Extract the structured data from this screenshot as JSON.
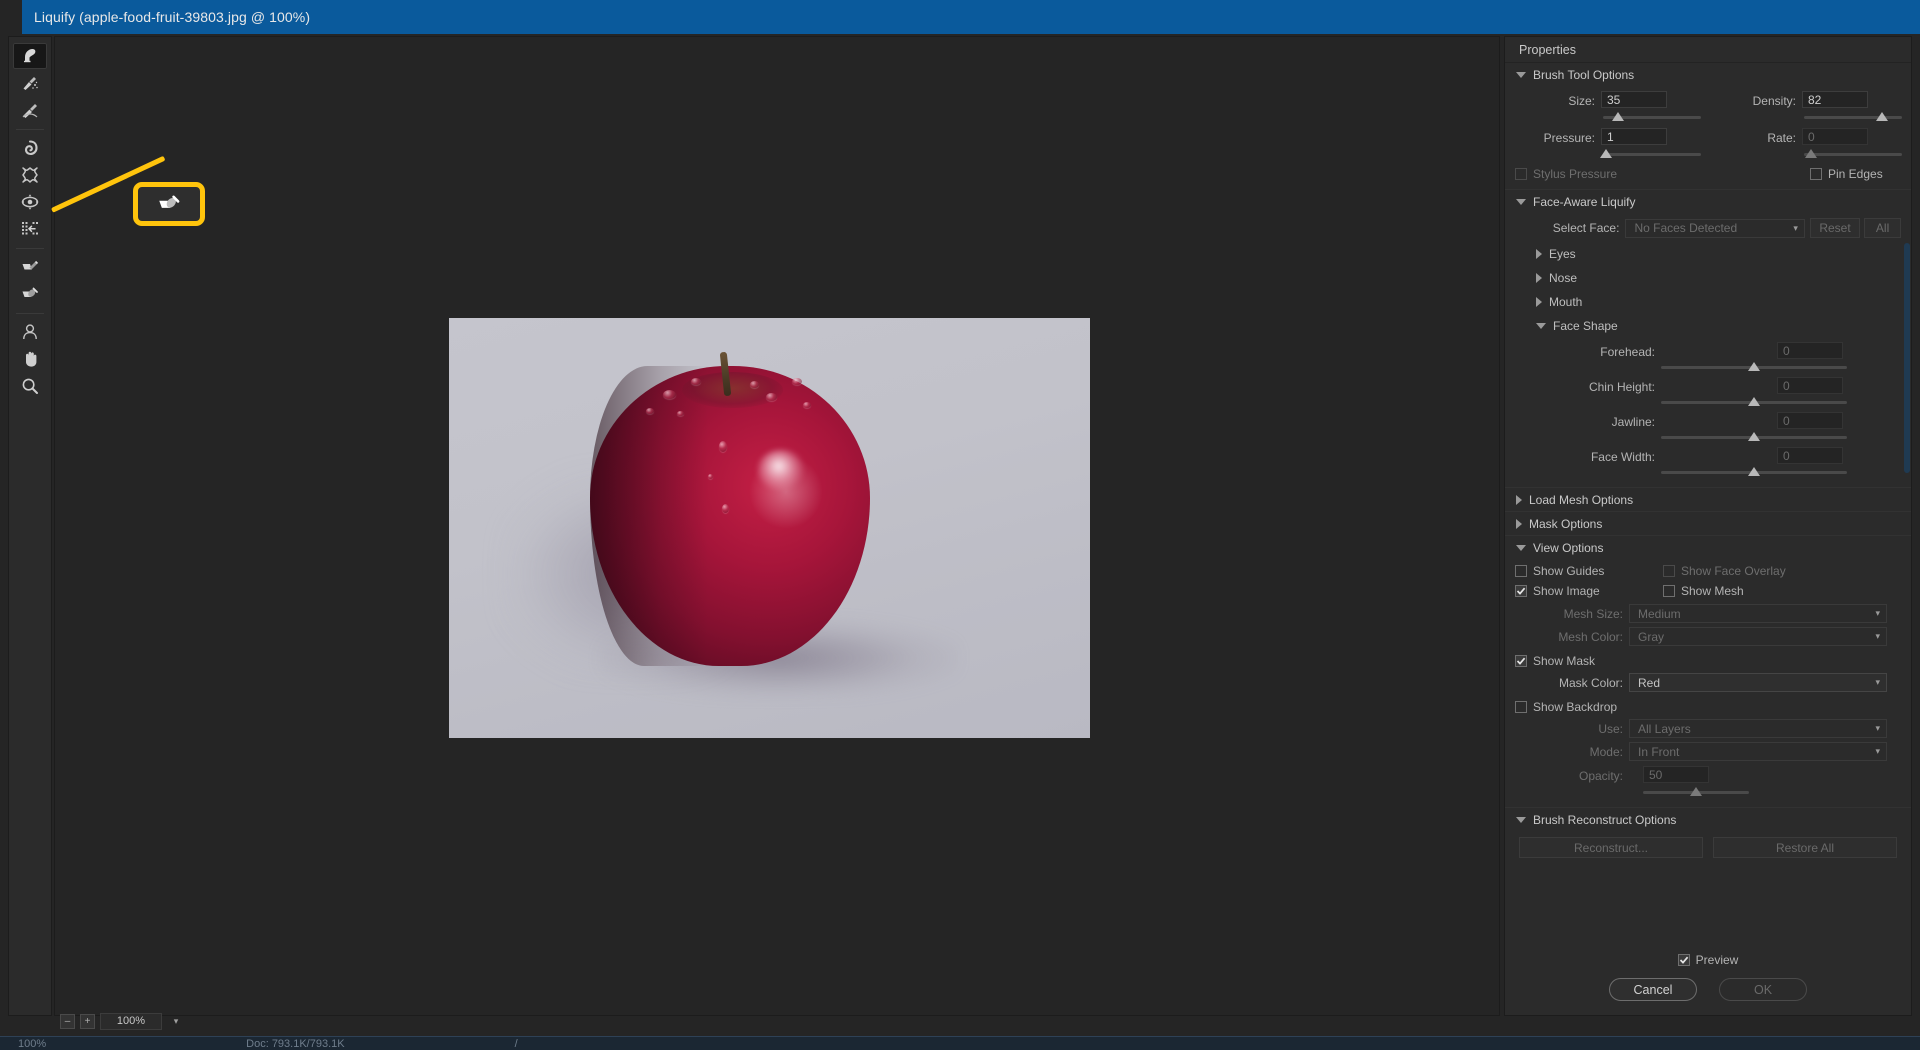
{
  "window": {
    "title": "Liquify (apple-food-fruit-39803.jpg @ 100%)"
  },
  "toolbar": {
    "tools": [
      {
        "name": "forward-warp-tool",
        "label": "Forward Warp Tool",
        "selected": true
      },
      {
        "name": "reconstruct-tool",
        "label": "Reconstruct Tool",
        "selected": false
      },
      {
        "name": "smooth-tool",
        "label": "Smooth Tool",
        "selected": false
      },
      {
        "name": "twirl-clockwise-tool",
        "label": "Twirl Clockwise Tool",
        "selected": false
      },
      {
        "name": "pucker-tool",
        "label": "Pucker Tool",
        "selected": false
      },
      {
        "name": "bloat-tool",
        "label": "Bloat Tool",
        "selected": false
      },
      {
        "name": "push-left-tool",
        "label": "Push Left Tool",
        "selected": false
      },
      {
        "name": "freeze-mask-tool",
        "label": "Freeze Mask Tool",
        "selected": false
      },
      {
        "name": "thaw-mask-tool",
        "label": "Thaw Mask Tool",
        "selected": false
      },
      {
        "name": "face-tool",
        "label": "Face Tool",
        "selected": false
      },
      {
        "name": "hand-tool",
        "label": "Hand Tool",
        "selected": false
      },
      {
        "name": "zoom-tool",
        "label": "Zoom Tool",
        "selected": false
      }
    ]
  },
  "annotation": {
    "highlight_color": "#ffc40c",
    "target_tool": "thaw-mask-tool",
    "target_label": "Thaw Mask Tool"
  },
  "zoombar": {
    "minus_label": "–",
    "plus_label": "+",
    "zoom_value": "100%",
    "caret": "⌵"
  },
  "statusbar": {
    "zoom": "100%",
    "doc": "Doc: 793.1K/793.1K",
    "extra": "/"
  },
  "properties": {
    "header": "Properties",
    "brush_tool_options": {
      "title": "Brush Tool Options",
      "expanded": true,
      "size": {
        "label": "Size:",
        "value": "35",
        "slider_pct": 15
      },
      "density": {
        "label": "Density:",
        "value": "82",
        "slider_pct": 80
      },
      "pressure": {
        "label": "Pressure:",
        "value": "1",
        "slider_pct": 3
      },
      "rate": {
        "label": "Rate:",
        "value": "0",
        "slider_pct": 7,
        "disabled": true
      },
      "stylus_pressure": {
        "label": "Stylus Pressure",
        "checked": false,
        "disabled": true
      },
      "pin_edges": {
        "label": "Pin Edges",
        "checked": false,
        "disabled": false
      }
    },
    "face_aware_liquify": {
      "title": "Face-Aware Liquify",
      "expanded": true,
      "select_face": {
        "label": "Select Face:",
        "value": "No Faces Detected",
        "disabled": true
      },
      "reset_button": "Reset",
      "all_button": "All",
      "groups": [
        {
          "label": "Eyes",
          "expanded": false
        },
        {
          "label": "Nose",
          "expanded": false
        },
        {
          "label": "Mouth",
          "expanded": false
        },
        {
          "label": "Face Shape",
          "expanded": true
        }
      ],
      "face_shape_sliders": [
        {
          "label": "Forehead:",
          "value": "0",
          "slider_pct": 50
        },
        {
          "label": "Chin Height:",
          "value": "0",
          "slider_pct": 50
        },
        {
          "label": "Jawline:",
          "value": "0",
          "slider_pct": 50
        },
        {
          "label": "Face Width:",
          "value": "0",
          "slider_pct": 50
        }
      ]
    },
    "load_mesh_options": {
      "title": "Load Mesh Options",
      "expanded": false
    },
    "mask_options": {
      "title": "Mask Options",
      "expanded": false
    },
    "view_options": {
      "title": "View Options",
      "expanded": true,
      "show_guides": {
        "label": "Show Guides",
        "checked": false,
        "disabled": false
      },
      "show_face_overlay": {
        "label": "Show Face Overlay",
        "checked": false,
        "disabled": true
      },
      "show_image": {
        "label": "Show Image",
        "checked": true,
        "disabled": false
      },
      "show_mesh": {
        "label": "Show Mesh",
        "checked": false,
        "disabled": false
      },
      "mesh_size": {
        "label": "Mesh Size:",
        "value": "Medium",
        "disabled": true
      },
      "mesh_color": {
        "label": "Mesh Color:",
        "value": "Gray",
        "disabled": true
      },
      "show_mask": {
        "label": "Show Mask",
        "checked": true,
        "disabled": false
      },
      "mask_color": {
        "label": "Mask Color:",
        "value": "Red",
        "disabled": false
      },
      "show_backdrop": {
        "label": "Show Backdrop",
        "checked": false,
        "disabled": false
      },
      "use": {
        "label": "Use:",
        "value": "All Layers",
        "disabled": true
      },
      "mode": {
        "label": "Mode:",
        "value": "In Front",
        "disabled": true
      },
      "opacity": {
        "label": "Opacity:",
        "value": "50",
        "slider_pct": 50,
        "disabled": true
      }
    },
    "brush_reconstruct_options": {
      "title": "Brush Reconstruct Options",
      "expanded": true,
      "reconstruct_button": {
        "label": "Reconstruct...",
        "disabled": true
      },
      "restore_all_button": {
        "label": "Restore All",
        "disabled": true
      }
    },
    "footer": {
      "preview": {
        "label": "Preview",
        "checked": true
      },
      "cancel_button": {
        "label": "Cancel",
        "disabled": false
      },
      "ok_button": {
        "label": "OK",
        "disabled": true
      }
    }
  }
}
